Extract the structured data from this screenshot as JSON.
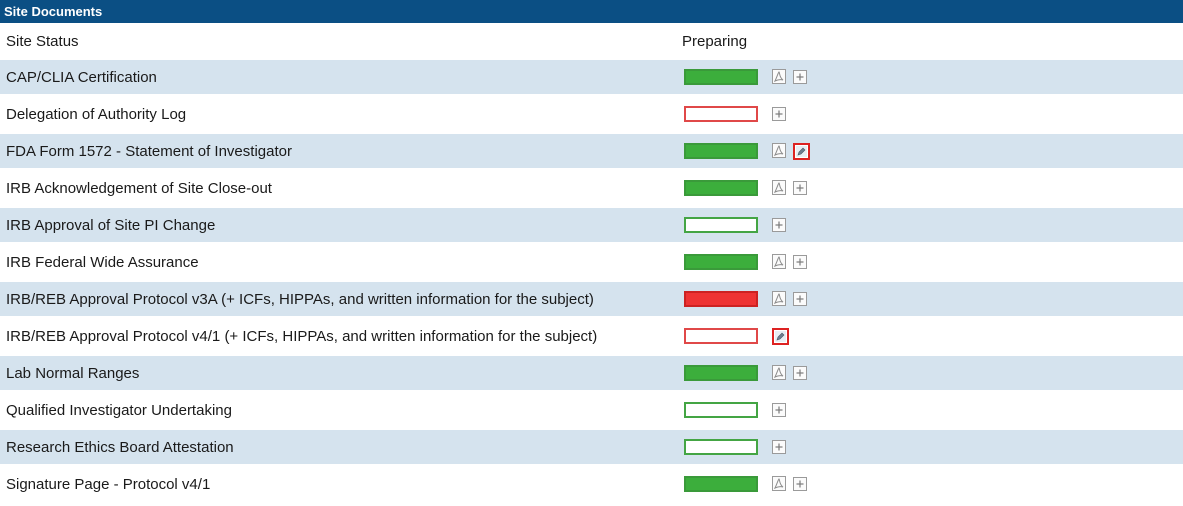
{
  "panel": {
    "title": "Site Documents"
  },
  "status_row": {
    "label": "Site Status",
    "value": "Preparing"
  },
  "documents": [
    {
      "name": "CAP/CLIA Certification",
      "bar": "green",
      "icons": [
        "pdf-icon",
        "add-icon"
      ]
    },
    {
      "name": "Delegation of Authority Log",
      "bar": "empty-red",
      "icons": [
        "add-icon"
      ]
    },
    {
      "name": "FDA Form 1572 - Statement of Investigator",
      "bar": "green",
      "icons": [
        "pdf-icon",
        "edit-icon"
      ]
    },
    {
      "name": "IRB Acknowledgement of Site Close-out",
      "bar": "green",
      "icons": [
        "pdf-icon",
        "add-icon"
      ]
    },
    {
      "name": "IRB Approval of Site PI Change",
      "bar": "empty-green",
      "icons": [
        "add-icon"
      ]
    },
    {
      "name": "IRB Federal Wide Assurance",
      "bar": "green",
      "icons": [
        "pdf-icon",
        "add-icon"
      ]
    },
    {
      "name": "IRB/REB Approval Protocol v3A (+ ICFs, HIPPAs, and written information for the subject)",
      "bar": "red",
      "icons": [
        "pdf-icon",
        "add-icon"
      ]
    },
    {
      "name": "IRB/REB Approval Protocol v4/1 (+ ICFs, HIPPAs, and written information for the subject)",
      "bar": "empty-red",
      "icons": [
        "edit-icon"
      ]
    },
    {
      "name": "Lab Normal Ranges",
      "bar": "green",
      "icons": [
        "pdf-icon",
        "add-icon"
      ]
    },
    {
      "name": "Qualified Investigator Undertaking",
      "bar": "empty-green",
      "icons": [
        "add-icon"
      ]
    },
    {
      "name": "Research Ethics Board Attestation",
      "bar": "empty-green",
      "icons": [
        "add-icon"
      ]
    },
    {
      "name": "Signature Page - Protocol v4/1",
      "bar": "green",
      "icons": [
        "pdf-icon",
        "add-icon"
      ]
    }
  ],
  "colors": {
    "header_bg": "#0b4f84",
    "row_alt_bg": "#d5e3ee",
    "complete": "#3cae3c",
    "rejected": "#ee3333",
    "missing_border": "#e04848",
    "pending_border": "#44a544"
  }
}
